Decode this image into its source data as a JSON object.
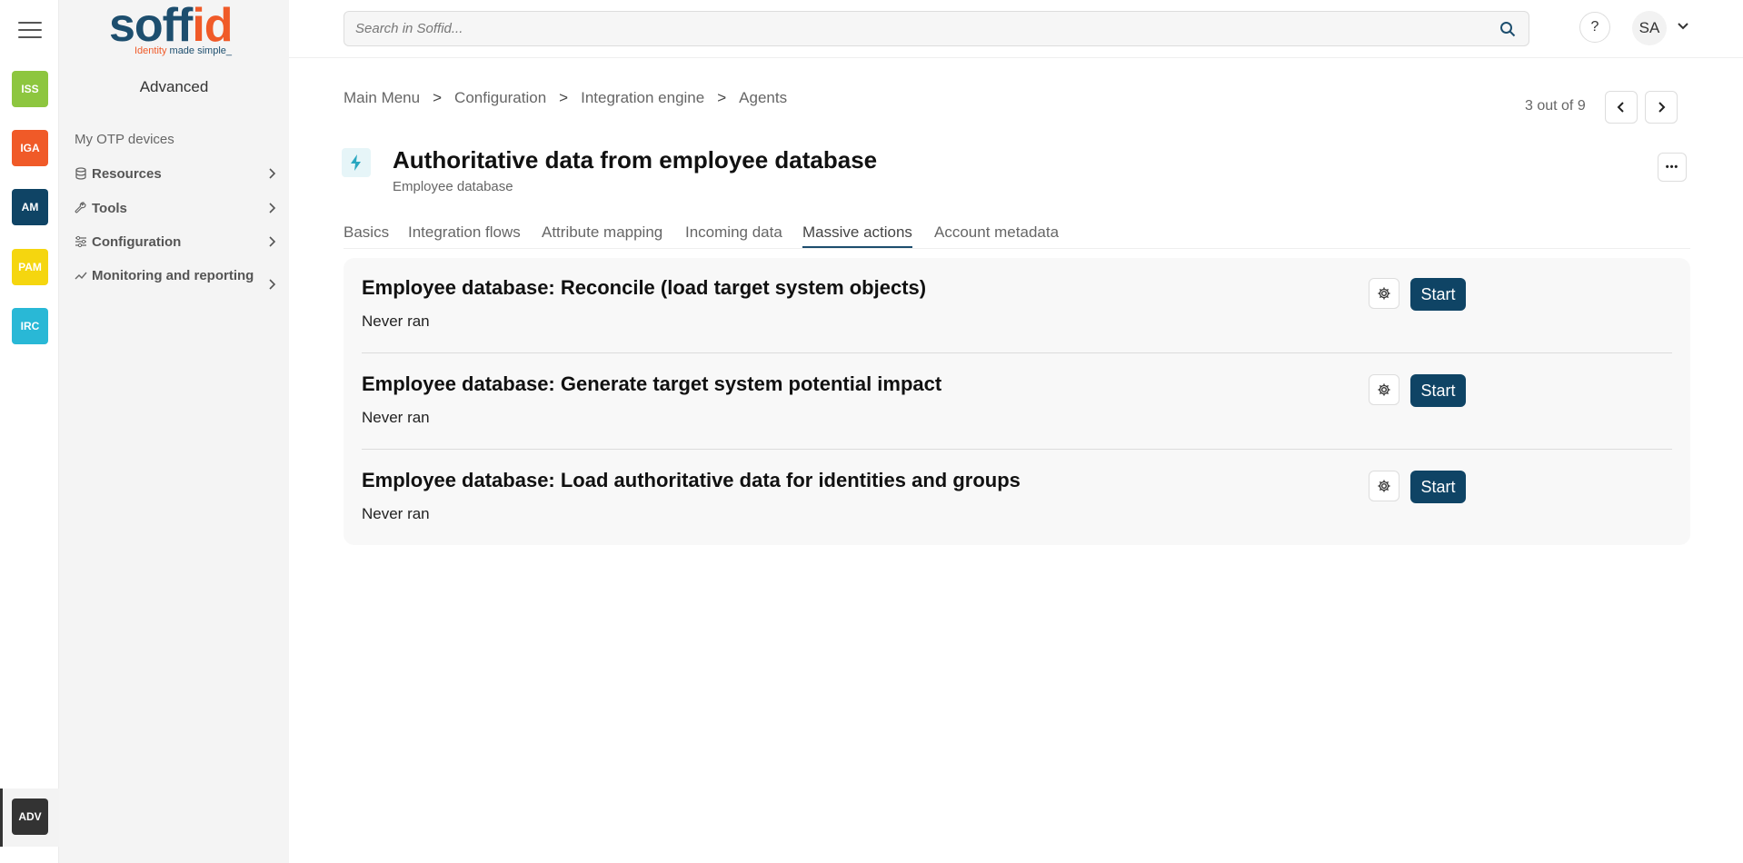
{
  "rail": {
    "tiles": [
      {
        "label": "ISS",
        "color": "#8dc63f"
      },
      {
        "label": "IGA",
        "color": "#f05a28"
      },
      {
        "label": "AM",
        "color": "#0f4465"
      },
      {
        "label": "PAM",
        "color": "#f5d60f"
      },
      {
        "label": "IRC",
        "color": "#29b8d6"
      }
    ],
    "active": {
      "label": "ADV",
      "color": "#333333"
    }
  },
  "logo": {
    "word_main": "soff",
    "word_accent": "id",
    "tag_accent": "Identity",
    "tag_main": " made simple_"
  },
  "sidebar": {
    "section_title": "Advanced",
    "link": "My OTP devices",
    "items": [
      {
        "label": "Resources",
        "icon": "database-icon"
      },
      {
        "label": "Tools",
        "icon": "wrench-icon"
      },
      {
        "label": "Configuration",
        "icon": "sliders-icon"
      },
      {
        "label": "Monitoring and reporting",
        "icon": "chart-line-icon"
      }
    ]
  },
  "topbar": {
    "search_placeholder": "Search in Soffid...",
    "help_label": "?",
    "avatar_initials": "SA"
  },
  "breadcrumb": {
    "items": [
      "Main Menu",
      "Configuration",
      "Integration engine",
      "Agents"
    ],
    "separator": ">"
  },
  "pager": {
    "text": "3 out of 9"
  },
  "header": {
    "title": "Authoritative data from employee database",
    "subtitle": "Employee database",
    "more_label": "•••"
  },
  "tabs": [
    {
      "label": "Basics"
    },
    {
      "label": "Integration flows"
    },
    {
      "label": "Attribute mapping"
    },
    {
      "label": "Incoming data"
    },
    {
      "label": "Massive actions",
      "active": true
    },
    {
      "label": "Account metadata"
    }
  ],
  "actions": [
    {
      "title": "Employee database: Reconcile (load target system objects)",
      "status": "Never ran",
      "button": "Start"
    },
    {
      "title": "Employee database: Generate target system potential impact",
      "status": "Never ran",
      "button": "Start"
    },
    {
      "title": "Employee database: Load authoritative data for identities and groups",
      "status": "Never ran",
      "button": "Start"
    }
  ],
  "colors": {
    "brand": "#0f4465",
    "accent": "#f05a28"
  }
}
